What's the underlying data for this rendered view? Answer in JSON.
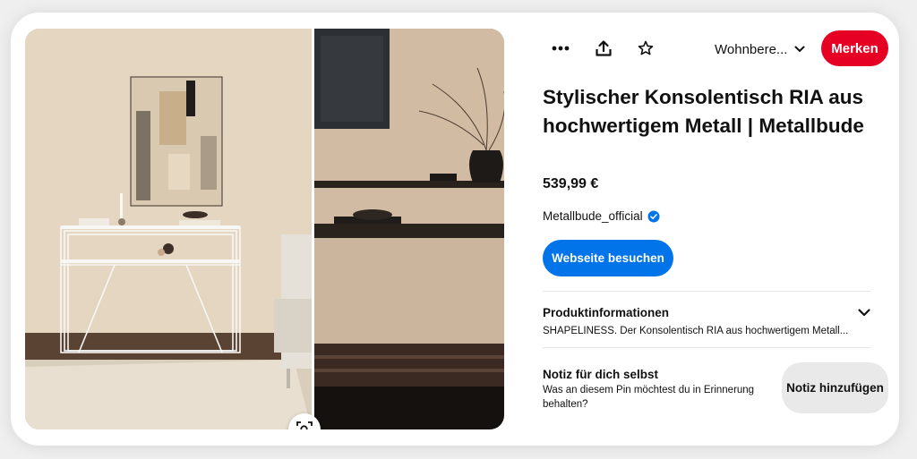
{
  "header": {
    "more_icon": "more-dots-icon",
    "share_icon": "share-icon",
    "favorite_icon": "star-icon",
    "board_name": "Wohnbere...",
    "save_label": "Merken",
    "save_color": "#e60023"
  },
  "pin": {
    "title": "Stylischer Konsolentisch RIA aus hochwertigem Metall | Metallbude",
    "price": "539,99 €",
    "creator": "Metallbude_official",
    "verified_icon": "verified-check-icon",
    "visit_label": "Webseite besuchen",
    "visit_color": "#0074e8"
  },
  "product_info": {
    "heading": "Produktinformationen",
    "description": "SHAPELINESS. Der Konsolentisch RIA aus hochwertigem Metall..."
  },
  "note": {
    "heading": "Notiz für dich selbst",
    "description": "Was an diesem Pin möchtest du in Erinnerung behalten?",
    "button_label": "Notiz hinzufügen"
  },
  "image": {
    "lens_icon": "visual-search-icon"
  }
}
